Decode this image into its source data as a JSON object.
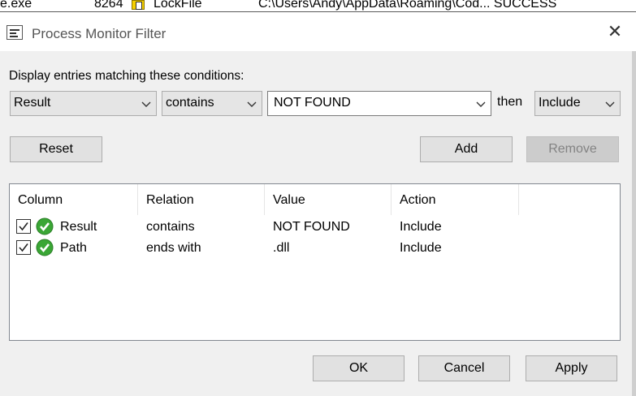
{
  "background_row": {
    "process": "e.exe",
    "pid": "8264",
    "operation": "LockFile",
    "path_result": "C:\\Users\\Andy\\AppData\\Roaming\\Cod... SUCCESS"
  },
  "window": {
    "title": "Process Monitor Filter",
    "close_glyph": "✕"
  },
  "filter": {
    "prompt": "Display entries matching these conditions:",
    "column": "Result",
    "relation": "contains",
    "value": "NOT FOUND",
    "then_label": "then",
    "action": "Include"
  },
  "buttons": {
    "reset": "Reset",
    "add": "Add",
    "remove": "Remove",
    "ok": "OK",
    "cancel": "Cancel",
    "apply": "Apply"
  },
  "list": {
    "headers": [
      "Column",
      "Relation",
      "Value",
      "Action"
    ],
    "rows": [
      {
        "checked": true,
        "column": "Result",
        "relation": "contains",
        "value": "NOT FOUND",
        "action": "Include"
      },
      {
        "checked": true,
        "column": "Path",
        "relation": "ends with",
        "value": ".dll",
        "action": "Include"
      }
    ]
  },
  "icons": {
    "app": "filter-window-icon",
    "close": "close-icon",
    "dropdown": "chevron-down-icon",
    "row_status": "green-check-icon",
    "checkbox": "checkbox-checked-icon"
  },
  "colors": {
    "accent_green": "#3aa635",
    "disabled_text": "#838383",
    "dialog_bg": "#f0f0f0"
  }
}
